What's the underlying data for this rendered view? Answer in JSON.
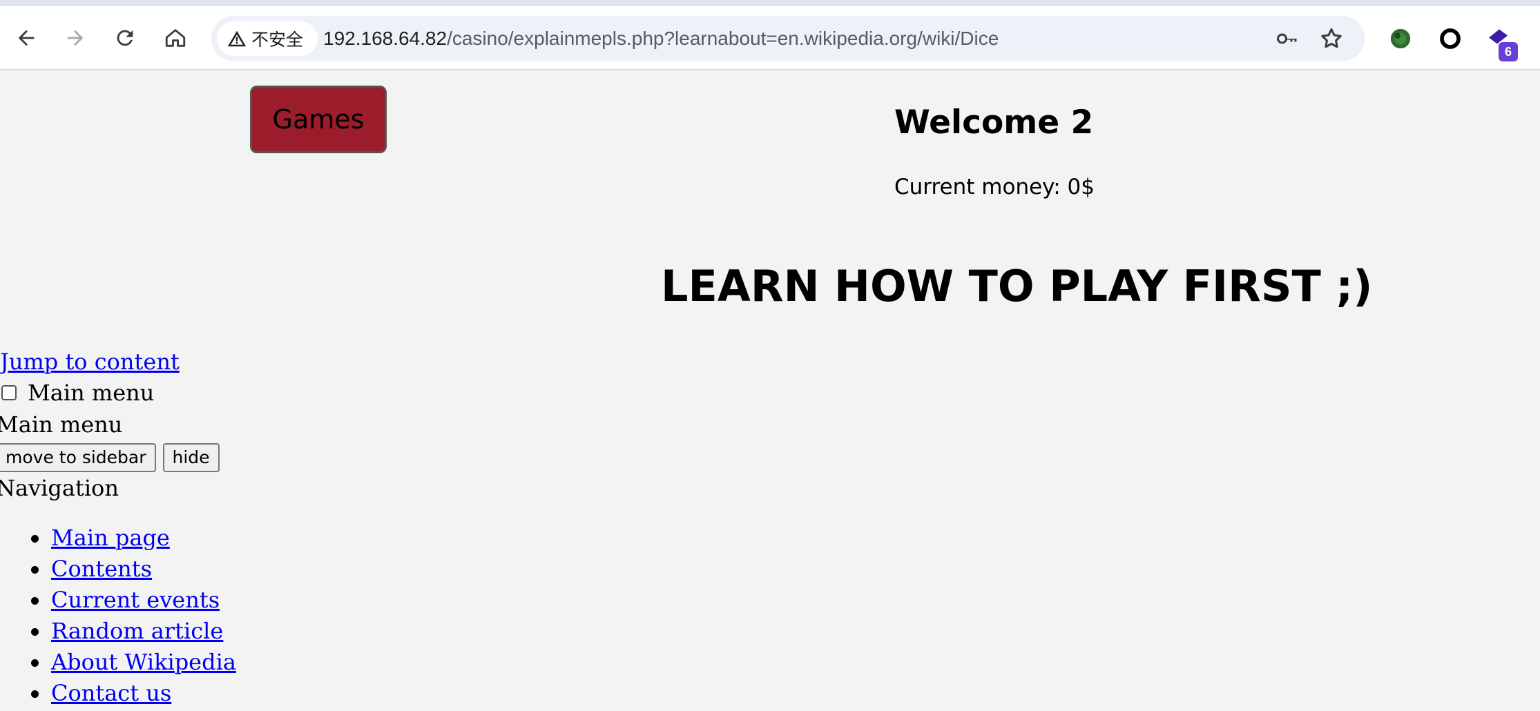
{
  "browser": {
    "security_label": "不安全",
    "url_host": "192.168.64.82",
    "url_path": "/casino/explainmepls.php?learnabout=en.wikipedia.org/wiki/Dice",
    "extension_badge": "6",
    "icons": [
      "back-icon",
      "forward-icon",
      "reload-icon",
      "home-icon",
      "warning-icon",
      "key-icon",
      "star-icon",
      "extension-icon",
      "circle-extension-icon",
      "extensions-puzzle-icon"
    ]
  },
  "page": {
    "games_label": "Games",
    "welcome": "Welcome 2",
    "money": "Current money: 0$",
    "learn_banner": "LEARN HOW TO PLAY FIRST ;)"
  },
  "wiki": {
    "jump_link": "Jump to content",
    "main_menu_checkbox_label": "Main menu",
    "main_menu_heading": "Main menu",
    "move_button": "move to sidebar",
    "hide_button": "hide",
    "navigation_heading": "Navigation",
    "nav_items": [
      "Main page",
      "Contents",
      "Current events",
      "Random article",
      "About Wikipedia",
      "Contact us"
    ]
  },
  "colors": {
    "games_button": "#9b1c2b",
    "link": "#0000ee",
    "page_bg": "#f3f3f3"
  }
}
